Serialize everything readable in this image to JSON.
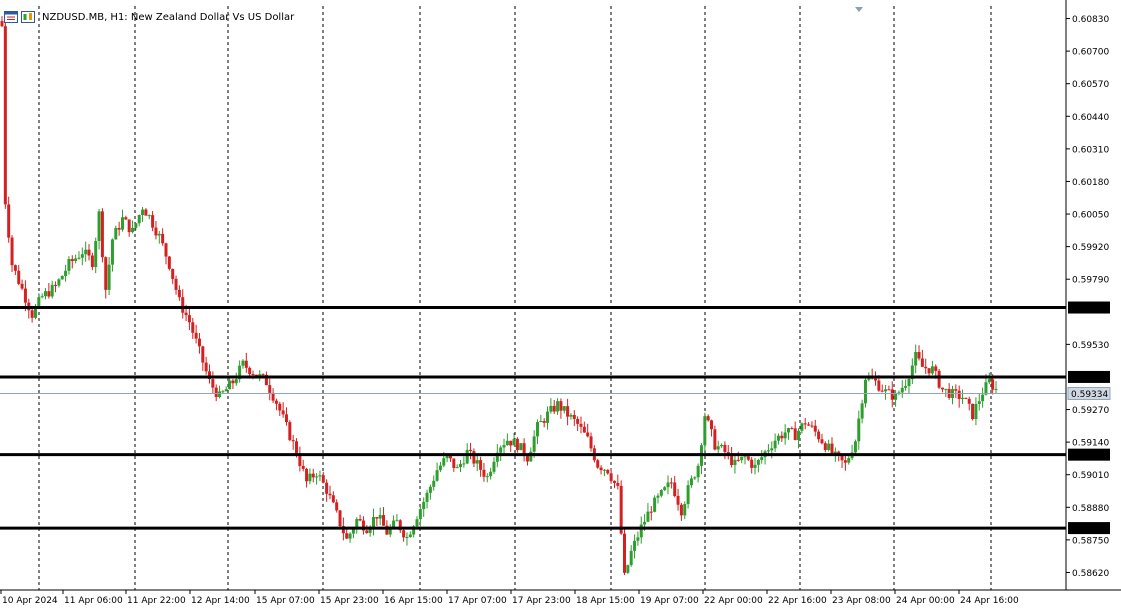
{
  "header": {
    "title": "NZDUSD.MB, H1:  New Zealand Dollar Vs US Dollar"
  },
  "icons": [
    "chart-window-icon",
    "chart-list-icon"
  ],
  "colors": {
    "bull": "#2e9e2e",
    "bear": "#d42020",
    "grid": "#000000",
    "level_line": "#000000",
    "bid_line": "#8fa6b8",
    "bid_label_bg": "#cfd8e0"
  },
  "chart_data": {
    "type": "candlestick",
    "title": "NZDUSD.MB, H1:  New Zealand Dollar Vs US Dollar",
    "symbol": "NZDUSD.MB",
    "timeframe": "H1",
    "ylim": [
      0.5855,
      0.6088
    ],
    "y_ticks": [
      "0.60830",
      "0.60700",
      "0.60570",
      "0.60440",
      "0.60310",
      "0.60180",
      "0.60050",
      "0.59920",
      "0.59790",
      "0.59530",
      "0.59270",
      "0.59140",
      "0.59010",
      "0.58880",
      "0.58750",
      "0.58620"
    ],
    "x_ticks": [
      "10 Apr 2024",
      "11 Apr 06:00",
      "11 Apr 22:00",
      "12 Apr 14:00",
      "15 Apr 07:00",
      "15 Apr 23:00",
      "16 Apr 15:00",
      "17 Apr 07:00",
      "17 Apr 23:00",
      "18 Apr 15:00",
      "19 Apr 07:00",
      "22 Apr 00:00",
      "22 Apr 16:00",
      "23 Apr 08:00",
      "24 Apr 00:00",
      "24 Apr 16:00"
    ],
    "grid": "vertical dashed",
    "levels": [
      {
        "label": "0.59677",
        "value": 0.59677
      },
      {
        "label": "0.59400",
        "value": 0.594
      },
      {
        "label": "0.59090",
        "value": 0.5909
      },
      {
        "label": "0.58797",
        "value": 0.58797
      }
    ],
    "bid": {
      "label": "0.59334",
      "value": 0.59334
    },
    "close_path": [
      [
        0,
        0.608
      ],
      [
        1,
        0.601
      ],
      [
        3,
        0.5985
      ],
      [
        6,
        0.5975
      ],
      [
        9,
        0.5965
      ],
      [
        12,
        0.5972
      ],
      [
        16,
        0.5976
      ],
      [
        20,
        0.5985
      ],
      [
        24,
        0.599
      ],
      [
        27,
        0.5986
      ],
      [
        29,
        0.6005
      ],
      [
        31,
        0.5975
      ],
      [
        33,
        0.5995
      ],
      [
        36,
        0.6003
      ],
      [
        39,
        0.5998
      ],
      [
        42,
        0.6008
      ],
      [
        44,
        0.6004
      ],
      [
        47,
        0.5996
      ],
      [
        50,
        0.5985
      ],
      [
        53,
        0.597
      ],
      [
        56,
        0.5962
      ],
      [
        59,
        0.595
      ],
      [
        62,
        0.5938
      ],
      [
        65,
        0.5932
      ],
      [
        69,
        0.5938
      ],
      [
        72,
        0.5945
      ],
      [
        75,
        0.5942
      ],
      [
        79,
        0.5938
      ],
      [
        82,
        0.593
      ],
      [
        85,
        0.592
      ],
      [
        88,
        0.591
      ],
      [
        91,
        0.5898
      ],
      [
        94,
        0.5902
      ],
      [
        97,
        0.5895
      ],
      [
        100,
        0.5885
      ],
      [
        103,
        0.5875
      ],
      [
        106,
        0.5883
      ],
      [
        109,
        0.588
      ],
      [
        112,
        0.5885
      ],
      [
        115,
        0.5878
      ],
      [
        118,
        0.5882
      ],
      [
        121,
        0.5876
      ],
      [
        124,
        0.5885
      ],
      [
        127,
        0.5893
      ],
      [
        130,
        0.5903
      ],
      [
        133,
        0.5908
      ],
      [
        136,
        0.5903
      ],
      [
        139,
        0.591
      ],
      [
        142,
        0.5905
      ],
      [
        145,
        0.59
      ],
      [
        148,
        0.5912
      ],
      [
        151,
        0.5915
      ],
      [
        154,
        0.5913
      ],
      [
        157,
        0.5908
      ],
      [
        160,
        0.592
      ],
      [
        163,
        0.5925
      ],
      [
        166,
        0.5929
      ],
      [
        169,
        0.5925
      ],
      [
        172,
        0.5921
      ],
      [
        175,
        0.5915
      ],
      [
        178,
        0.5905
      ],
      [
        181,
        0.5903
      ],
      [
        184,
        0.5895
      ],
      [
        186,
        0.586
      ],
      [
        188,
        0.587
      ],
      [
        191,
        0.588
      ],
      [
        194,
        0.5888
      ],
      [
        197,
        0.5893
      ],
      [
        200,
        0.5898
      ],
      [
        203,
        0.5887
      ],
      [
        205,
        0.5895
      ],
      [
        208,
        0.5905
      ],
      [
        210,
        0.5925
      ],
      [
        213,
        0.5913
      ],
      [
        216,
        0.591
      ],
      [
        219,
        0.5905
      ],
      [
        222,
        0.5908
      ],
      [
        225,
        0.5904
      ],
      [
        228,
        0.591
      ],
      [
        231,
        0.5915
      ],
      [
        234,
        0.5918
      ],
      [
        237,
        0.5917
      ],
      [
        240,
        0.5922
      ],
      [
        243,
        0.5918
      ],
      [
        246,
        0.5913
      ],
      [
        249,
        0.5908
      ],
      [
        252,
        0.5905
      ],
      [
        255,
        0.5915
      ],
      [
        258,
        0.594
      ],
      [
        261,
        0.5938
      ],
      [
        264,
        0.5934
      ],
      [
        267,
        0.5932
      ],
      [
        270,
        0.5938
      ],
      [
        273,
        0.5948
      ],
      [
        275,
        0.5944
      ],
      [
        278,
        0.5943
      ],
      [
        281,
        0.5935
      ],
      [
        284,
        0.5933
      ],
      [
        287,
        0.5932
      ],
      [
        290,
        0.5925
      ],
      [
        293,
        0.5934
      ],
      [
        295,
        0.5938
      ],
      [
        297,
        0.5935
      ]
    ]
  }
}
